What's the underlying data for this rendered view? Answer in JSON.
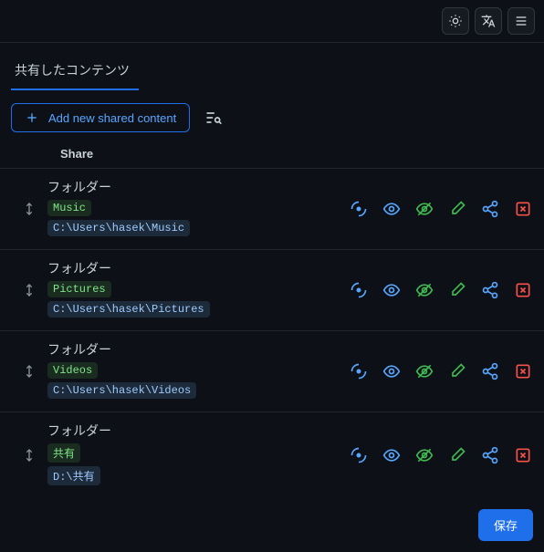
{
  "topbar": {
    "theme_icon": "theme-icon",
    "lang_icon": "language-icon",
    "menu_icon": "menu-icon"
  },
  "tab": {
    "label": "共有したコンテンツ"
  },
  "toolbar": {
    "add_label": "Add new shared content",
    "search_icon": "filter-search-icon"
  },
  "table": {
    "header_share": "Share",
    "folder_label": "フォルダー",
    "rows": [
      {
        "name": "Music",
        "path": "C:\\Users\\hasek\\Music"
      },
      {
        "name": "Pictures",
        "path": "C:\\Users\\hasek\\Pictures"
      },
      {
        "name": "Videos",
        "path": "C:\\Users\\hasek\\Videos"
      },
      {
        "name": "共有",
        "path": "D:\\共有"
      }
    ]
  },
  "actions": {
    "scan": "scan-icon",
    "visible": "eye-icon",
    "hidden": "eye-off-icon",
    "edit": "edit-icon",
    "share": "share-icon",
    "delete": "delete-icon"
  },
  "footer": {
    "save_label": "保存"
  },
  "colors": {
    "blue": "#58a6ff",
    "green": "#3fb950",
    "red": "#f85149"
  }
}
